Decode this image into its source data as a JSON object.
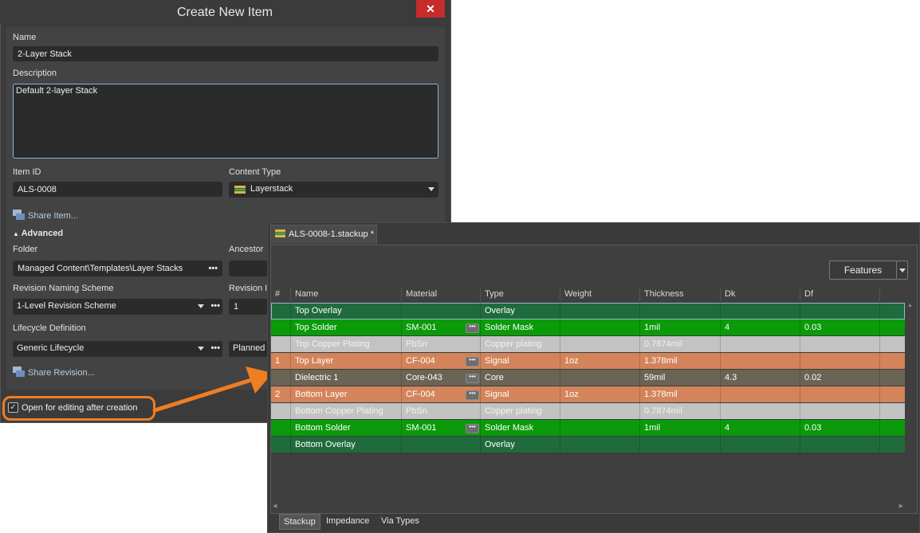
{
  "dialog": {
    "title": "Create New Item",
    "close_glyph": "✕",
    "name_label": "Name",
    "name_value": "2-Layer Stack",
    "description_label": "Description",
    "description_value": "Default 2-layer Stack",
    "item_id_label": "Item ID",
    "item_id_value": "ALS-0008",
    "content_type_label": "Content Type",
    "content_type_value": "Layerstack",
    "share_item_link": "Share Item...",
    "advanced_label": "Advanced",
    "folder_label": "Folder",
    "folder_value": "Managed Content\\Templates\\Layer Stacks",
    "ancestor_label": "Ancestor",
    "revision_naming_label": "Revision Naming Scheme",
    "revision_naming_value": "1-Level Revision Scheme",
    "revision_label": "Revision I",
    "revision_value": "1",
    "lifecycle_label": "Lifecycle Definition",
    "lifecycle_value": "Generic Lifecycle",
    "lifecycle_state_value": "Planned",
    "share_revision_link": "Share Revision...",
    "open_after_creation_label": "Open for editing after creation",
    "open_after_creation_checked": true
  },
  "stackup": {
    "tab_label": "ALS-0008-1.stackup *",
    "features_label": "Features",
    "columns": [
      "#",
      "Name",
      "Material",
      "Type",
      "Weight",
      "Thickness",
      "Dk",
      "Df"
    ],
    "rows": [
      {
        "num": "",
        "name": "Top Overlay",
        "material": "",
        "type": "Overlay",
        "weight": "",
        "thickness": "",
        "dk": "",
        "df": "",
        "bg": "#1f6b3c",
        "fg": "#ffffff",
        "mat_btn": false
      },
      {
        "num": "",
        "name": "Top Solder",
        "material": "SM-001",
        "type": "Solder Mask",
        "weight": "",
        "thickness": "1mil",
        "dk": "4",
        "df": "0.03",
        "bg": "#0a9a0a",
        "fg": "#ffffff",
        "mat_btn": true
      },
      {
        "num": "",
        "name": "Top Copper Plating",
        "material": "PbSn",
        "type": "Copper plating",
        "weight": "",
        "thickness": "0.7874mil",
        "dk": "",
        "df": "",
        "bg": "#c3c3c3",
        "fg": "#f2f2f2",
        "mat_btn": false
      },
      {
        "num": "1",
        "name": "Top Layer",
        "material": "CF-004",
        "type": "Signal",
        "weight": "1oz",
        "thickness": "1.378mil",
        "dk": "",
        "df": "",
        "bg": "#d4845a",
        "fg": "#ffffff",
        "mat_btn": true
      },
      {
        "num": "",
        "name": "Dielectric 1",
        "material": "Core-043",
        "type": "Core",
        "weight": "",
        "thickness": "59mil",
        "dk": "4.3",
        "df": "0.02",
        "bg": "#6a6455",
        "fg": "#ffffff",
        "mat_btn": true
      },
      {
        "num": "2",
        "name": "Bottom Layer",
        "material": "CF-004",
        "type": "Signal",
        "weight": "1oz",
        "thickness": "1.378mil",
        "dk": "",
        "df": "",
        "bg": "#d4845a",
        "fg": "#ffffff",
        "mat_btn": true
      },
      {
        "num": "",
        "name": "Bottom Copper Plating",
        "material": "PbSn",
        "type": "Copper plating",
        "weight": "",
        "thickness": "0.7874mil",
        "dk": "",
        "df": "",
        "bg": "#c3c3c3",
        "fg": "#f2f2f2",
        "mat_btn": false
      },
      {
        "num": "",
        "name": "Bottom Solder",
        "material": "SM-001",
        "type": "Solder Mask",
        "weight": "",
        "thickness": "1mil",
        "dk": "4",
        "df": "0.03",
        "bg": "#0a9a0a",
        "fg": "#ffffff",
        "mat_btn": true
      },
      {
        "num": "",
        "name": "Bottom Overlay",
        "material": "",
        "type": "Overlay",
        "weight": "",
        "thickness": "",
        "dk": "",
        "df": "",
        "bg": "#1f6b3c",
        "fg": "#ffffff",
        "mat_btn": false
      }
    ],
    "bottom_tabs": [
      "Stackup",
      "Impedance",
      "Via Types"
    ],
    "active_bottom_tab": "Stackup"
  },
  "colors": {
    "highlight": "#ef7d22",
    "close_button": "#c72b2b"
  }
}
